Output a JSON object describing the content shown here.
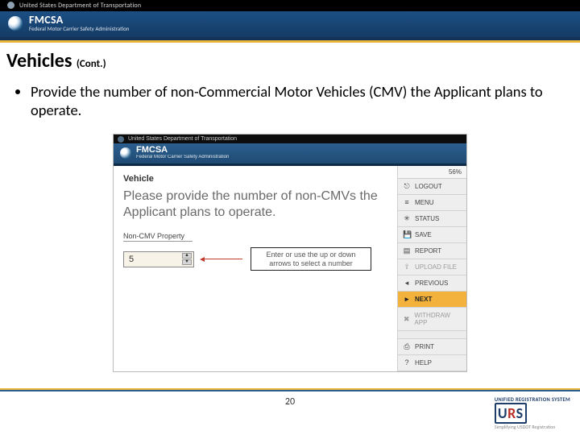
{
  "banner": {
    "dot": "United States Department of Transportation",
    "fmcsa": "FMCSA",
    "fmcsa_sub": "Federal Motor Carrier Safety Administration"
  },
  "slide": {
    "title": "Vehicles",
    "cont": "(Cont.)",
    "bullet": "Provide the number of non-Commercial Motor Vehicles (CMV) the Applicant plans to operate."
  },
  "shot": {
    "dot": "United States Department of Transportation",
    "fmcsa": "FMCSA",
    "fmcsa_sub": "Federal Motor Carrier Safety Administration",
    "heading": "Vehicle",
    "question": "Please provide the number of non-CMVs the Applicant plans to operate.",
    "property_label": "Non-CMV Property",
    "value": "5",
    "callout": "Enter or use the up or down arrows to select a number",
    "percent": "56%",
    "menu": {
      "logout": "LOGOUT",
      "menu": "MENU",
      "status": "STATUS",
      "save": "SAVE",
      "report": "REPORT",
      "upload": "UPLOAD FILE",
      "previous": "PREVIOUS",
      "next": "NEXT",
      "withdraw": "WITHDRAW APP",
      "print": "PRINT",
      "help": "HELP"
    }
  },
  "page_number": "20",
  "urs": {
    "top": "UNIFIED REGISTRATION SYSTEM",
    "bottom": "Simplifying USDOT Registration"
  }
}
